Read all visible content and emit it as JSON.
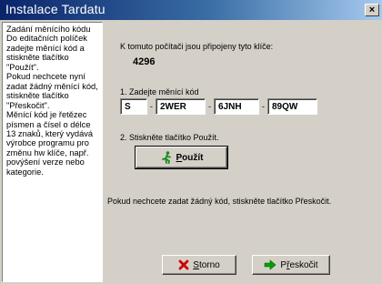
{
  "window": {
    "title": "Instalace Tardatu",
    "close_glyph": "×"
  },
  "help_text": "Zadání měnícího kódu\nDo editačních políček zadejte měnící kód a stiskněte tlačítko \"Použít\".\nPokud nechcete nyní zadat žádný měnící kód, stiskněte tlačítko \"Přeskočit\".\nMěnící kód je řetězec písmen a čísel o délce 13 znaků, který vydává výrobce programu pro změnu hw klíče, např. povýšení verze nebo kategorie.",
  "main": {
    "keys_label": "K tomuto počítači jsou připojeny tyto klíče:",
    "key_code": "4296",
    "step1_label": "1. Zadejte měnící kód",
    "fields": [
      "S",
      "2WER",
      "6JNH",
      "89QW"
    ],
    "separator": "-",
    "step2_label": "2. Stiskněte tlačítko Použít.",
    "use_button": {
      "underlined": "P",
      "rest": "oužít",
      "icon": "running-man-icon"
    },
    "skip_note": "Pokud nechcete zadat žádný kód, stiskněte tlačítko Přeskočit."
  },
  "footer": {
    "cancel_button": {
      "underlined": "S",
      "rest": "torno",
      "icon": "red-x-icon"
    },
    "skip_button": {
      "underlined": "ř",
      "prefix": "P",
      "rest": "eskočit",
      "icon": "green-arrow-icon"
    }
  },
  "colors": {
    "title_start": "#0a246a",
    "title_end": "#a6caf0",
    "face": "#d4d0c8",
    "cancel_icon": "#cc0000",
    "skip_icon": "#00a000"
  }
}
